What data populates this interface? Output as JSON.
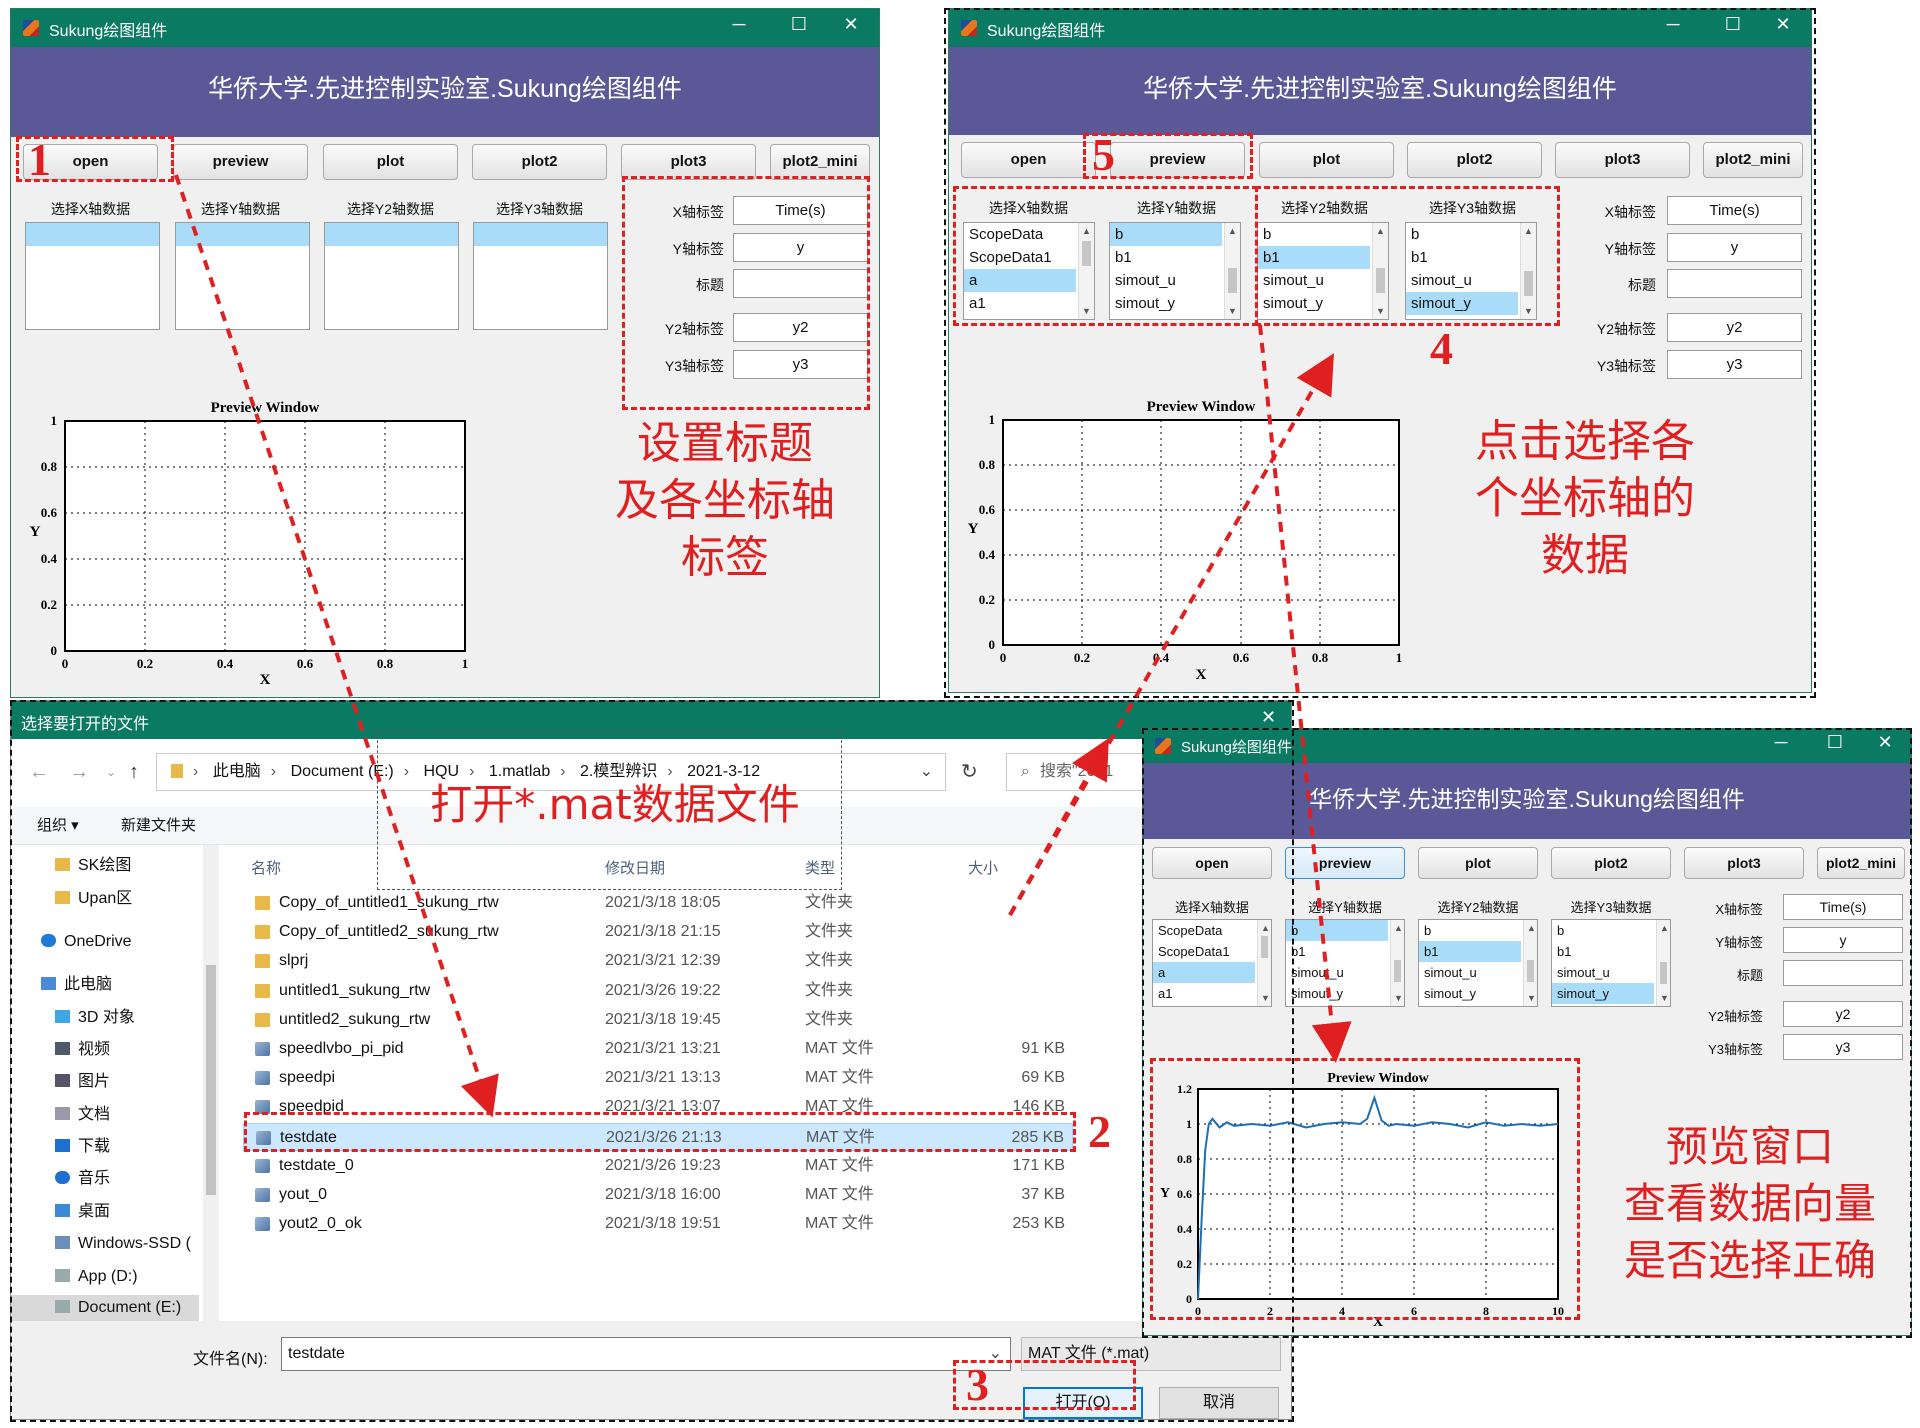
{
  "app_title": "Sukung绘图组件",
  "banner": "华侨大学.先进控制实验室.Sukung绘图组件",
  "buttons": {
    "open": "open",
    "preview": "preview",
    "plot": "plot",
    "plot2": "plot2",
    "plot3": "plot3",
    "plot2_mini": "plot2_mini"
  },
  "labels": {
    "x_data": "选择X轴数据",
    "y_data": "选择Y轴数据",
    "y2_data": "选择Y2轴数据",
    "y3_data": "选择Y3轴数据",
    "x_axis": "X轴标签",
    "y_axis": "Y轴标签",
    "title": "标题",
    "y2_axis": "Y2轴标签",
    "y3_axis": "Y3轴标签"
  },
  "inputs": {
    "x_axis": "Time(s)",
    "y_axis": "y",
    "title": "",
    "y2_axis": "y2",
    "y3_axis": "y3"
  },
  "lists": {
    "x": [
      "ScopeData",
      "ScopeData1",
      "a",
      "a1"
    ],
    "y": [
      "b",
      "b1",
      "simout_u",
      "simout_y"
    ],
    "y2": [
      "b",
      "b1",
      "simout_u",
      "simout_y"
    ],
    "y3": [
      "b",
      "b1",
      "simout_u",
      "simout_y"
    ]
  },
  "preview": {
    "title": "Preview  Window",
    "xlabel": "X",
    "ylabel": "Y",
    "empty_xticks": [
      "0",
      "0.2",
      "0.4",
      "0.6",
      "0.8",
      "1"
    ],
    "empty_yticks": [
      "0",
      "0.2",
      "0.4",
      "0.6",
      "0.8",
      "1"
    ],
    "filled_xticks": [
      "0",
      "2",
      "4",
      "6",
      "8",
      "10"
    ],
    "filled_yticks": [
      "0",
      "0.2",
      "0.4",
      "0.6",
      "0.8",
      "1",
      "1.2"
    ]
  },
  "chart_data": {
    "type": "line",
    "title": "Preview  Window",
    "xlabel": "X",
    "ylabel": "Y",
    "xlim": [
      0,
      10
    ],
    "ylim": [
      0,
      1.2
    ],
    "grid": true,
    "series": [
      {
        "color": "#1f6fb5",
        "x": [
          0,
          0.1,
          0.2,
          0.3,
          0.4,
          0.6,
          0.8,
          1,
          1.5,
          2,
          2.5,
          3,
          3.5,
          4,
          4.5,
          4.7,
          4.9,
          5.1,
          5.3,
          5.5,
          6,
          6.5,
          7,
          7.5,
          8,
          8.5,
          9,
          9.5,
          10
        ],
        "y": [
          0,
          0.45,
          0.85,
          1.0,
          1.03,
          0.98,
          1.01,
          0.99,
          1.0,
          0.99,
          1.01,
          0.98,
          1.0,
          1.01,
          1.0,
          1.03,
          1.15,
          1.02,
          0.99,
          1.0,
          0.99,
          1.01,
          1.0,
          0.98,
          1.01,
          0.99,
          1.0,
          0.99,
          1.0
        ]
      }
    ]
  },
  "dialog": {
    "title": "选择要打开的文件",
    "breadcrumb": [
      "此电脑",
      "Document (E:)",
      "HQU",
      "1.matlab",
      "2.模型辨识",
      "2021-3-12"
    ],
    "search_placeholder": "搜索\"2021",
    "organize": "组织 ▾",
    "new_folder": "新建文件夹",
    "columns": {
      "name": "名称",
      "date": "修改日期",
      "type": "类型",
      "size": "大小"
    },
    "nav": [
      "SK绘图",
      "Upan区",
      "OneDrive",
      "此电脑",
      "3D 对象",
      "视频",
      "图片",
      "文档",
      "下载",
      "音乐",
      "桌面",
      "Windows-SSD (",
      "App (D:)",
      "Document (E:)"
    ],
    "files": [
      {
        "name": "Copy_of_untitled1_sukung_rtw",
        "date": "2021/3/18 18:05",
        "type": "文件夹",
        "size": "",
        "kind": "folder"
      },
      {
        "name": "Copy_of_untitled2_sukung_rtw",
        "date": "2021/3/18 21:15",
        "type": "文件夹",
        "size": "",
        "kind": "folder"
      },
      {
        "name": "slprj",
        "date": "2021/3/21 12:39",
        "type": "文件夹",
        "size": "",
        "kind": "folder"
      },
      {
        "name": "untitled1_sukung_rtw",
        "date": "2021/3/26 19:22",
        "type": "文件夹",
        "size": "",
        "kind": "folder"
      },
      {
        "name": "untitled2_sukung_rtw",
        "date": "2021/3/18 19:45",
        "type": "文件夹",
        "size": "",
        "kind": "folder"
      },
      {
        "name": "speedlvbo_pi_pid",
        "date": "2021/3/21 13:21",
        "type": "MAT 文件",
        "size": "91 KB",
        "kind": "mat"
      },
      {
        "name": "speedpi",
        "date": "2021/3/21 13:13",
        "type": "MAT 文件",
        "size": "69 KB",
        "kind": "mat"
      },
      {
        "name": "speedpid",
        "date": "2021/3/21 13:07",
        "type": "MAT 文件",
        "size": "146 KB",
        "kind": "mat"
      },
      {
        "name": "testdate",
        "date": "2021/3/26 21:13",
        "type": "MAT 文件",
        "size": "285 KB",
        "kind": "mat"
      },
      {
        "name": "testdate_0",
        "date": "2021/3/26 19:23",
        "type": "MAT 文件",
        "size": "171 KB",
        "kind": "mat"
      },
      {
        "name": "yout_0",
        "date": "2021/3/18 16:00",
        "type": "MAT 文件",
        "size": "37 KB",
        "kind": "mat"
      },
      {
        "name": "yout2_0_ok",
        "date": "2021/3/18 19:51",
        "type": "MAT 文件",
        "size": "253 KB",
        "kind": "mat"
      }
    ],
    "filename_label": "文件名(N):",
    "filename_value": "testdate",
    "filter": "MAT 文件 (*.mat)",
    "open_button": "打开(O)",
    "cancel_button": "取消"
  },
  "annotations": {
    "n1": "1",
    "n2": "2",
    "n3": "3",
    "n4": "4",
    "n5": "5",
    "set_title": "设置标题\n及各坐标轴\n标签",
    "select_data": "点击选择各\n个坐标轴的\n数据",
    "open_mat": "打开*.mat数据文件",
    "preview_check": "预览窗口\n查看数据向量\n是否选择正确"
  },
  "colors": {
    "titlebar": "#0b7a63",
    "banner": "#5b5897",
    "selection": "#a9dcf8",
    "annotation": "#e02020",
    "series": "#1f6fb5"
  }
}
